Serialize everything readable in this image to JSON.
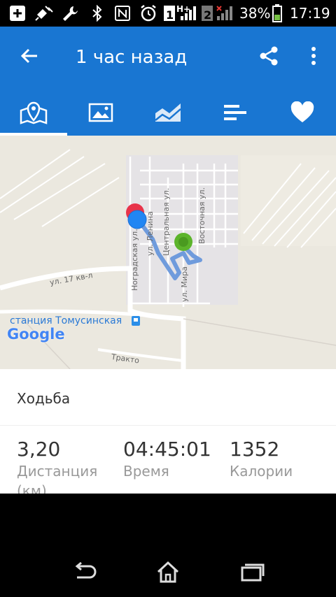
{
  "status_bar": {
    "sim1": "1",
    "sim2": "2",
    "network": "H+",
    "battery_percent": "38%",
    "time": "17:19",
    "icons": [
      "add-box-icon",
      "satellite-icon",
      "wrench-icon",
      "bluetooth-icon",
      "nfc-icon",
      "alarm-icon",
      "signal-icon",
      "battery-icon"
    ]
  },
  "header": {
    "title": "1 час назад",
    "back_icon": "arrow-back-icon",
    "share_icon": "share-icon",
    "more_icon": "more-vert-icon"
  },
  "tabs": [
    {
      "icon": "map-icon",
      "selected": true
    },
    {
      "icon": "photo-icon",
      "selected": false
    },
    {
      "icon": "chart-icon",
      "selected": false
    },
    {
      "icon": "list-icon",
      "selected": false
    },
    {
      "icon": "heart-icon",
      "selected": false
    }
  ],
  "map": {
    "streets": [
      "ул. 17 кв-л",
      "Ноградская ул.",
      "ул. Ленина",
      "Центральная ул.",
      "Восточная ул.",
      "ул. Мира",
      "Тракто"
    ],
    "station": "станция Томусинская",
    "attribution": "Google",
    "colors": {
      "route": "#6f9bdc",
      "start": "#5cb42b",
      "end": "#e8334a",
      "position": "#2186f3"
    }
  },
  "activity": {
    "name": "Ходьба",
    "unit_partial": "(км)",
    "stats": [
      {
        "value": "3,20",
        "label": "Дистанция"
      },
      {
        "value": "04:45:01",
        "label": "Время"
      },
      {
        "value": "1352",
        "label": "Калории"
      }
    ]
  },
  "nav": {
    "back": "back-icon",
    "home": "home-icon",
    "recents": "recents-icon"
  },
  "colors": {
    "primary": "#1976d2",
    "accent": "#ffffff"
  }
}
